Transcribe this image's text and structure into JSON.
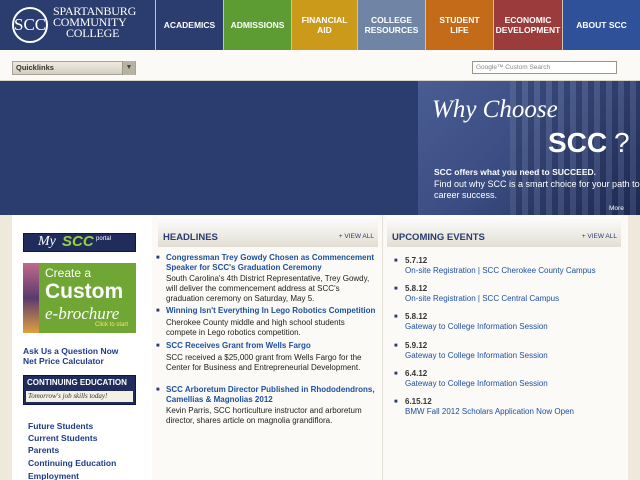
{
  "logo": {
    "mark": "SCC",
    "line1": "SPARTANBURG",
    "line2": "COMMUNITY",
    "line3": "COLLEGE"
  },
  "nav": [
    {
      "label": "ACADEMICS"
    },
    {
      "label": "ADMISSIONS"
    },
    {
      "label": "FINANCIAL AID"
    },
    {
      "label": "COLLEGE RESOURCES"
    },
    {
      "label": "STUDENT LIFE"
    },
    {
      "label": "ECONOMIC DEVELOPMENT"
    },
    {
      "label": "ABOUT SCC"
    }
  ],
  "toolbar": {
    "quicklinks": "Quicklinks",
    "search_placeholder": "Google™ Custom Search"
  },
  "promo": {
    "why": "Why Choose",
    "scc": "SCC",
    "q": "?",
    "tagline": "SCC offers what you need to SUCCEED.",
    "body": "Find out why SCC is a smart choice for your path to career success.",
    "more": "More"
  },
  "left": {
    "myscc_my": "My",
    "myscc_scc": "SCC",
    "myscc_portal": "portal",
    "eb_create": "Create a",
    "eb_custom": "Custom",
    "eb_brochure": "e-brochure",
    "eb_click": "Click to start",
    "ask": "Ask Us a Question Now",
    "calc": "Net Price Calculator",
    "contedu_title": "CONTINUING EDUCATION",
    "contedu_tag": "Tomorrow's job skills today!",
    "audiences": [
      "Future Students",
      "Current Students",
      "Parents",
      "Continuing Education",
      "Employment"
    ]
  },
  "headlines": {
    "title": "HEADLINES",
    "view_all": "+ VIEW ALL",
    "items": [
      {
        "title": "Congressman Trey Gowdy Chosen as Commencement Speaker for SCC's Graduation Ceremony",
        "body": "South Carolina's 4th District Representative, Trey Gowdy, will deliver the commencement address at SCC's graduation ceremony on Saturday, May 5."
      },
      {
        "title": "Winning Isn't Everything In Lego Robotics Competition",
        "body": "Cherokee County middle and high school students compete in Lego robotics competition."
      },
      {
        "title": "SCC Receives Grant from Wells Fargo",
        "body": "SCC received a $25,000 grant from Wells Fargo for the Center for Business and Entrepreneurial Development."
      },
      {
        "title": "SCC Arboretum Director Published in Rhododendrons, Camellias & Magnolias 2012",
        "body": "Kevin Parris, SCC horticulture instructor and arboretum director, shares article on magnolia grandiflora."
      }
    ]
  },
  "events": {
    "title": "UPCOMING EVENTS",
    "view_all": "+ VIEW ALL",
    "items": [
      {
        "date": "5.7.12",
        "title": "On-site Registration | SCC Cherokee County Campus"
      },
      {
        "date": "5.8.12",
        "title": "On-site Registration | SCC Central Campus"
      },
      {
        "date": "5.8.12",
        "title": "Gateway to College Information Session"
      },
      {
        "date": "5.9.12",
        "title": "Gateway to College Information Session"
      },
      {
        "date": "6.4.12",
        "title": "Gateway to College Information Session"
      },
      {
        "date": "6.15.12",
        "title": "BMW Fall 2012 Scholars Application Now Open"
      }
    ]
  }
}
